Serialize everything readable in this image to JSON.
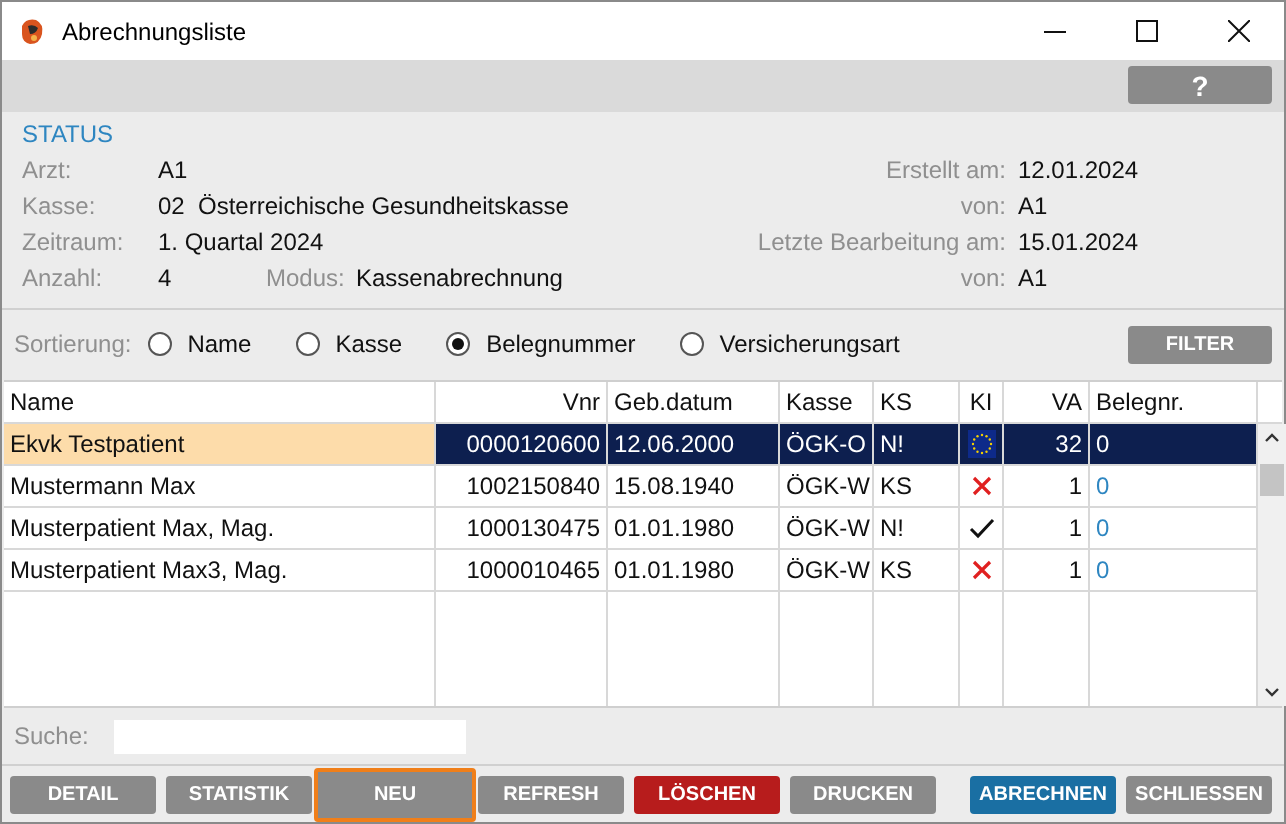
{
  "window": {
    "title": "Abrechnungsliste"
  },
  "help_button": "?",
  "status": {
    "title": "STATUS",
    "left": [
      [
        {
          "label": "Arzt:",
          "value": "A1"
        }
      ],
      [
        {
          "label": "Kasse:",
          "value": "02  Österreichische Gesundheitskasse"
        }
      ],
      [
        {
          "label": "Zeitraum:",
          "value": "1. Quartal 2024"
        }
      ],
      [
        {
          "label": "Anzahl:",
          "value": "4"
        },
        {
          "label": "Modus:",
          "value": "Kassenabrechnung"
        }
      ]
    ],
    "right": [
      {
        "label": "Erstellt am:",
        "value": "12.01.2024"
      },
      {
        "label": "von:",
        "value": "A1"
      },
      {
        "label": "Letzte Bearbeitung am:",
        "value": "15.01.2024"
      },
      {
        "label": "von:",
        "value": "A1"
      }
    ]
  },
  "sort": {
    "label": "Sortierung:",
    "options": [
      {
        "label": "Name",
        "selected": false
      },
      {
        "label": "Kasse",
        "selected": false
      },
      {
        "label": "Belegnummer",
        "selected": true
      },
      {
        "label": "Versicherungsart",
        "selected": false
      }
    ],
    "filter_button": "FILTER"
  },
  "table": {
    "columns": [
      "Name",
      "Vnr",
      "Geb.datum",
      "Kasse",
      "KS",
      "KI",
      "VA",
      "Belegnr."
    ],
    "rows": [
      {
        "name": "Ekvk Testpatient",
        "vnr": "0000120600",
        "geb": "12.06.2000",
        "kasse": "ÖGK-O",
        "ks": "N!",
        "ki": {
          "kind": "eu"
        },
        "va": "32",
        "belegnr": "0",
        "selected": true
      },
      {
        "name": "Mustermann Max",
        "vnr": "1002150840",
        "geb": "15.08.1940",
        "kasse": "ÖGK-W",
        "ks": "KS",
        "ki": {
          "kind": "cross"
        },
        "va": "1",
        "belegnr": "0",
        "selected": false
      },
      {
        "name": "Musterpatient Max, Mag.",
        "vnr": "1000130475",
        "geb": "01.01.1980",
        "kasse": "ÖGK-W",
        "ks": "N!",
        "ki": {
          "kind": "check"
        },
        "va": "1",
        "belegnr": "0",
        "selected": false
      },
      {
        "name": "Musterpatient Max3, Mag.",
        "vnr": "1000010465",
        "geb": "01.01.1980",
        "kasse": "ÖGK-W",
        "ks": "KS",
        "ki": {
          "kind": "cross"
        },
        "va": "1",
        "belegnr": "0",
        "selected": false
      }
    ]
  },
  "search": {
    "label": "Suche:"
  },
  "buttons": [
    {
      "label": "DETAIL",
      "kind": "default",
      "focused": false
    },
    {
      "label": "STATISTIK",
      "kind": "default",
      "focused": false
    },
    {
      "label": "NEU",
      "kind": "default",
      "focused": true
    },
    {
      "label": "REFRESH",
      "kind": "default",
      "focused": false
    },
    {
      "label": "LÖSCHEN",
      "kind": "danger",
      "focused": false
    },
    {
      "label": "DRUCKEN",
      "kind": "default",
      "focused": false
    },
    {
      "label": "ABRECHNEN",
      "kind": "primary",
      "focused": false
    },
    {
      "label": "SCHLIESSEN",
      "kind": "default",
      "focused": false
    }
  ]
}
